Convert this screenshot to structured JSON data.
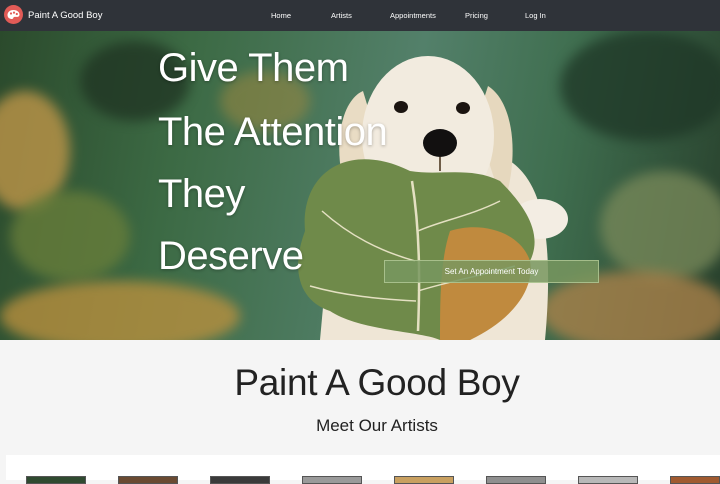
{
  "navbar": {
    "brand": "Paint A Good Boy",
    "links": [
      "Home",
      "Artists",
      "Appointments",
      "Pricing",
      "Log In"
    ],
    "logo_icon": "paint-palette-icon",
    "background": "#2f3339",
    "logo_color": "#e25b57"
  },
  "hero": {
    "headline": [
      "Give Them",
      "The Attention",
      "They",
      "Deserve"
    ],
    "cta": "Set An Appointment Today",
    "image": "golden-retriever-puppy-holding-leaf"
  },
  "main": {
    "title": "Paint A Good Boy",
    "subtitle": "Meet Our Artists",
    "artist_thumbnail_colors": [
      "#2f4a30",
      "#6a4a32",
      "#3a3a3a",
      "#9a9a9a",
      "#c9a060",
      "#8f8f8f",
      "#b8b8b8",
      "#a05a30"
    ]
  }
}
